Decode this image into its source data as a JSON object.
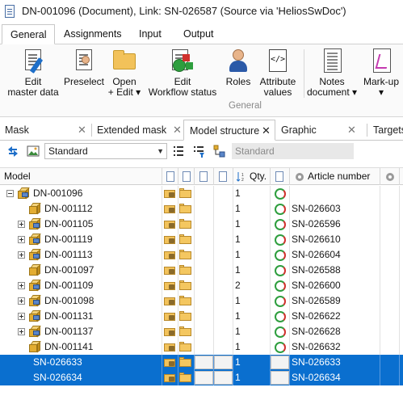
{
  "window": {
    "title": "DN-001096 (Document), Link: SN-026587 (Source via 'HeliosSwDoc')"
  },
  "ribbon_tabs": [
    "General",
    "Assignments",
    "Input",
    "Output"
  ],
  "ribbon": {
    "buttons": [
      {
        "l1": "Edit",
        "l2": "master data",
        "icon": "edit-document-icon"
      },
      {
        "l1": "Preselect",
        "l2": "",
        "icon": "preselect-icon"
      },
      {
        "l1": "Open",
        "l2": "+ Edit ▾",
        "icon": "folder-icon"
      },
      {
        "l1": "Edit",
        "l2": "Workflow status",
        "icon": "workflow-status-icon"
      },
      {
        "l1": "Roles",
        "l2": "",
        "icon": "roles-icon"
      },
      {
        "l1": "Attribute",
        "l2": "values",
        "icon": "attribute-values-icon"
      },
      {
        "l1": "Notes",
        "l2": "document ▾",
        "icon": "notes-icon"
      },
      {
        "l1": "Mark-up",
        "l2": "▾",
        "icon": "markup-icon"
      }
    ],
    "group_label": "General"
  },
  "panel_tabs": [
    {
      "label": "Mask",
      "close": "✕"
    },
    {
      "label": "Extended mask",
      "close": "✕"
    },
    {
      "label": "Model structure",
      "close": "✕"
    },
    {
      "label": "Graphic",
      "close": "✕"
    },
    {
      "label": "Targets",
      "close": ""
    }
  ],
  "toolbar": {
    "view_select": "Standard",
    "view_field": "Standard"
  },
  "grid": {
    "columns": {
      "model": "Model",
      "qty": "Qty.",
      "article": "Article number"
    },
    "rows": [
      {
        "name": "DN-001096",
        "qty": "1",
        "article": "",
        "expand": "minus",
        "level": 0,
        "icon": "assembly",
        "status": true,
        "selected": false
      },
      {
        "name": "DN-001112",
        "qty": "1",
        "article": "SN-026603",
        "expand": "",
        "level": 1,
        "icon": "part",
        "status": true,
        "selected": false
      },
      {
        "name": "DN-001105",
        "qty": "1",
        "article": "SN-026596",
        "expand": "plus",
        "level": 1,
        "icon": "assembly",
        "status": true,
        "selected": false
      },
      {
        "name": "DN-001119",
        "qty": "1",
        "article": "SN-026610",
        "expand": "plus",
        "level": 1,
        "icon": "assembly",
        "status": true,
        "selected": false
      },
      {
        "name": "DN-001113",
        "qty": "1",
        "article": "SN-026604",
        "expand": "plus",
        "level": 1,
        "icon": "assembly",
        "status": true,
        "selected": false
      },
      {
        "name": "DN-001097",
        "qty": "1",
        "article": "SN-026588",
        "expand": "",
        "level": 1,
        "icon": "part",
        "status": true,
        "selected": false
      },
      {
        "name": "DN-001109",
        "qty": "2",
        "article": "SN-026600",
        "expand": "plus",
        "level": 1,
        "icon": "assembly",
        "status": true,
        "selected": false
      },
      {
        "name": "DN-001098",
        "qty": "1",
        "article": "SN-026589",
        "expand": "plus",
        "level": 1,
        "icon": "assembly",
        "status": true,
        "selected": false
      },
      {
        "name": "DN-001131",
        "qty": "1",
        "article": "SN-026622",
        "expand": "plus",
        "level": 1,
        "icon": "assembly",
        "status": true,
        "selected": false
      },
      {
        "name": "DN-001137",
        "qty": "1",
        "article": "SN-026628",
        "expand": "plus",
        "level": 1,
        "icon": "assembly",
        "status": true,
        "selected": false
      },
      {
        "name": "DN-001141",
        "qty": "1",
        "article": "SN-026632",
        "expand": "",
        "level": 1,
        "icon": "part",
        "status": true,
        "selected": false
      },
      {
        "name": "SN-026633",
        "qty": "1",
        "article": "SN-026633",
        "expand": "",
        "level": 1,
        "icon": "",
        "status": false,
        "selected": true
      },
      {
        "name": "SN-026634",
        "qty": "1",
        "article": "SN-026634",
        "expand": "",
        "level": 1,
        "icon": "",
        "status": false,
        "selected": true
      }
    ]
  },
  "colors": {
    "selection": "#0a6fcf",
    "accent": "#1e6fc9"
  }
}
